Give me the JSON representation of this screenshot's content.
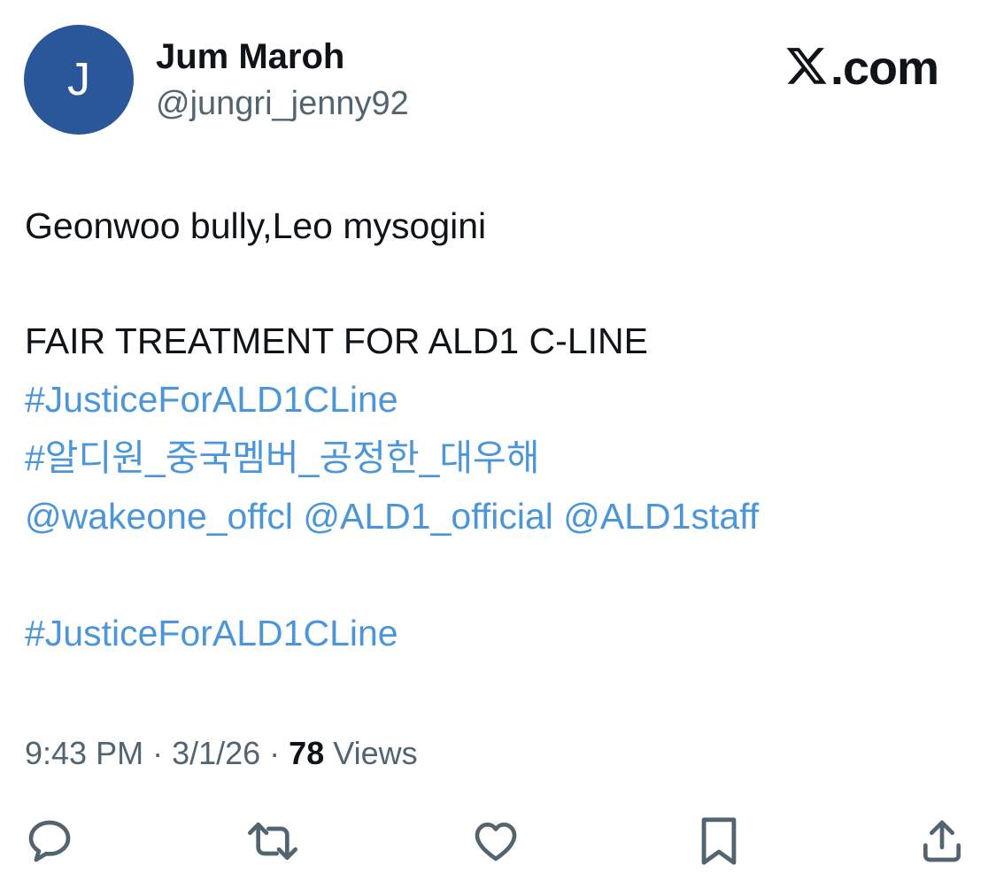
{
  "user": {
    "avatar_letter": "J",
    "avatar_color": "#2a579a",
    "display_name": "Jum Maroh",
    "handle": "@jungri_jenny92"
  },
  "brand": {
    "logo_icon": "x-logo-icon",
    "logo_suffix": ".com"
  },
  "tweet": {
    "line1": "Geonwoo bully,Leo mysogini",
    "line2": "FAIR TREATMENT FOR ALD1 C-LINE",
    "hashtag1": "#JusticeForALD1CLine",
    "hashtag2": "#알디원_중국멤버_공정한_대우해",
    "mentions": {
      "m1": "@wakeone_offcl",
      "m2": "@ALD1_official",
      "m3": "@ALD1staff"
    },
    "hashtag3": "#JusticeForALD1CLine"
  },
  "meta": {
    "time": "9:43 PM",
    "sep1": " · ",
    "date": "3/1/26",
    "sep2": " · ",
    "views_count": "78",
    "views_label": " Views"
  },
  "colors": {
    "link": "#4b95d9",
    "text": "#0f1419",
    "secondary": "#536471"
  },
  "actions": [
    "reply-icon",
    "retweet-icon",
    "like-icon",
    "bookmark-icon",
    "share-icon"
  ]
}
